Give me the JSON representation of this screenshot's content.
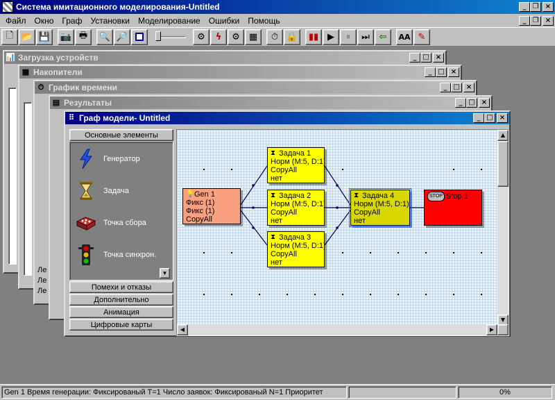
{
  "app": {
    "title": "Система имитационного моделирования-Untitled"
  },
  "menu": [
    {
      "label": "Файл"
    },
    {
      "label": "Окно"
    },
    {
      "label": "Граф"
    },
    {
      "label": "Установки"
    },
    {
      "label": "Моделирование"
    },
    {
      "label": "Ошибки"
    },
    {
      "label": "Помощь"
    }
  ],
  "toolbar_icons": [
    "new-icon",
    "open-icon",
    "save-icon",
    "camera-icon",
    "print-icon",
    "zoom-in-icon",
    "zoom-out-icon",
    "fit-icon",
    "zoom-slider",
    "generator-tool-icon",
    "lightning-tool-icon",
    "device-tool-icon",
    "storage-tool-icon",
    "timer-icon",
    "lock-icon",
    "record-icon",
    "play-icon",
    "pause-icon",
    "step-icon",
    "back-icon",
    "font-icon",
    "pen-icon"
  ],
  "windows": {
    "load": {
      "title": "Загрузка устройств"
    },
    "storage": {
      "title": "Накопители"
    },
    "time": {
      "title": "График времени"
    },
    "results": {
      "title": "Результаты"
    },
    "graph": {
      "title": "Граф модели- Untitled"
    }
  },
  "side_labels": [
    "Ле",
    "Ле",
    "Ле"
  ],
  "palette": {
    "header": "Основные элементы",
    "items": [
      {
        "label": "Генератор",
        "icon": "lightning-icon"
      },
      {
        "label": "Задача",
        "icon": "hourglass-icon"
      },
      {
        "label": "Точка сбора",
        "icon": "collector-icon"
      },
      {
        "label": "Точка синхрон.",
        "icon": "traffic-light-icon"
      }
    ],
    "buttons": [
      "Помехи и отказы",
      "Дополнительно",
      "Анимация",
      "Цифровые карты"
    ]
  },
  "nodes": {
    "gen1": {
      "title": "Gen 1",
      "lines": [
        "Фикс (1)",
        "Фикс (1)",
        "CopyAll"
      ]
    },
    "task1": {
      "title": "Задача 1",
      "lines": [
        "Норм (M:5, D:1)",
        "CopyAll",
        "нет"
      ]
    },
    "task2": {
      "title": "Задача 2",
      "lines": [
        "Норм (M:5, D:1)",
        "CopyAll",
        "нет"
      ]
    },
    "task3": {
      "title": "Задача 3",
      "lines": [
        "Норм (M:5, D:1)",
        "CopyAll",
        "нет"
      ]
    },
    "task4": {
      "title": "Задача 4",
      "lines": [
        "Норм (M:5, D:1)",
        "CopyAll",
        "нет"
      ]
    },
    "stop1": {
      "title": "Stop 1",
      "badge": "STOP"
    }
  },
  "status": {
    "text": "Gen 1  Время генерации:    Фиксированый   Т=1  Число заявок:     Фиксированый   N=1  Приоритет",
    "progress": "0%"
  },
  "colors": {
    "title_active": "#000080",
    "title_inactive": "#808080",
    "task": "#ffff00",
    "generator": "#f8a080",
    "stop": "#ff0000"
  }
}
